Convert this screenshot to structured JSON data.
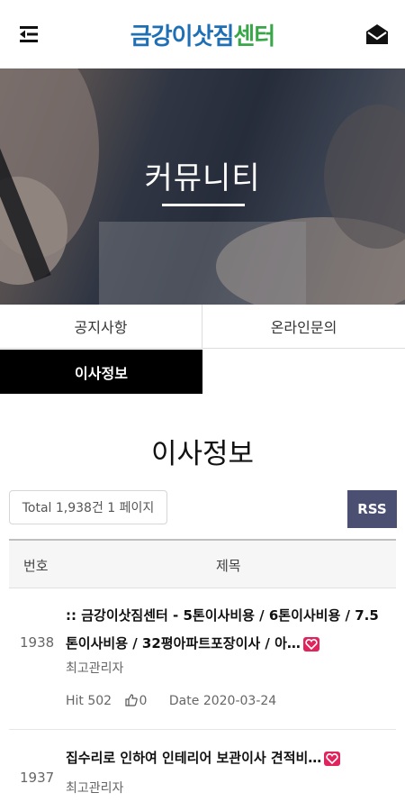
{
  "header": {
    "logo_part1": "금강이삿짐",
    "logo_part2": "센터",
    "menu_icon": "menu-icon",
    "mail_icon": "mail-icon"
  },
  "hero": {
    "title": "커뮤니티"
  },
  "tabs": [
    {
      "label": "공지사항"
    },
    {
      "label": "온라인문의"
    },
    {
      "label": "이사정보"
    }
  ],
  "page_title": "이사정보",
  "summary": {
    "total_text": "Total 1,938건 1 페이지"
  },
  "rss_label": "RSS",
  "table": {
    "headers": {
      "num": "번호",
      "title": "제목"
    },
    "rows": [
      {
        "num": "1938",
        "title": ":: 금강이삿짐센터 - 5톤이사비용 / 6톤이사비용 / 7.5톤이사비용 / 32평아파트포장이사 / 아…",
        "author": "최고관리자",
        "hit": "Hit 502",
        "likes": "0",
        "date": "Date 2020-03-24"
      },
      {
        "num": "1937",
        "title": "집수리로 인하여 인테리어 보관이사 견적비…",
        "author": "최고관리자"
      }
    ]
  },
  "colors": {
    "logo_blue": "#1f6fb5",
    "logo_green": "#3aa64a",
    "rss_bg": "#4b4f72",
    "heart": "#e0245e"
  }
}
